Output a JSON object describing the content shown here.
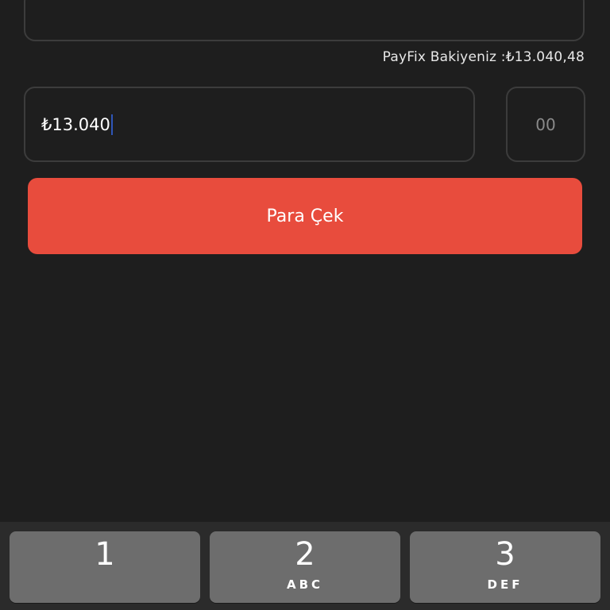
{
  "form": {
    "balance_label": "PayFix Bakiyeniz :₺13.040,48",
    "amount_value": "₺13.040",
    "cents_placeholder": "00",
    "withdraw_label": "Para Çek"
  },
  "keyboard": {
    "keys": [
      {
        "digit": "1",
        "letters": ""
      },
      {
        "digit": "2",
        "letters": "ABC"
      },
      {
        "digit": "3",
        "letters": "DEF"
      }
    ]
  },
  "colors": {
    "background": "#1e1e1e",
    "accent": "#e84c3d",
    "field_border": "#3c3c3c",
    "key_background": "#6d6d6d"
  }
}
